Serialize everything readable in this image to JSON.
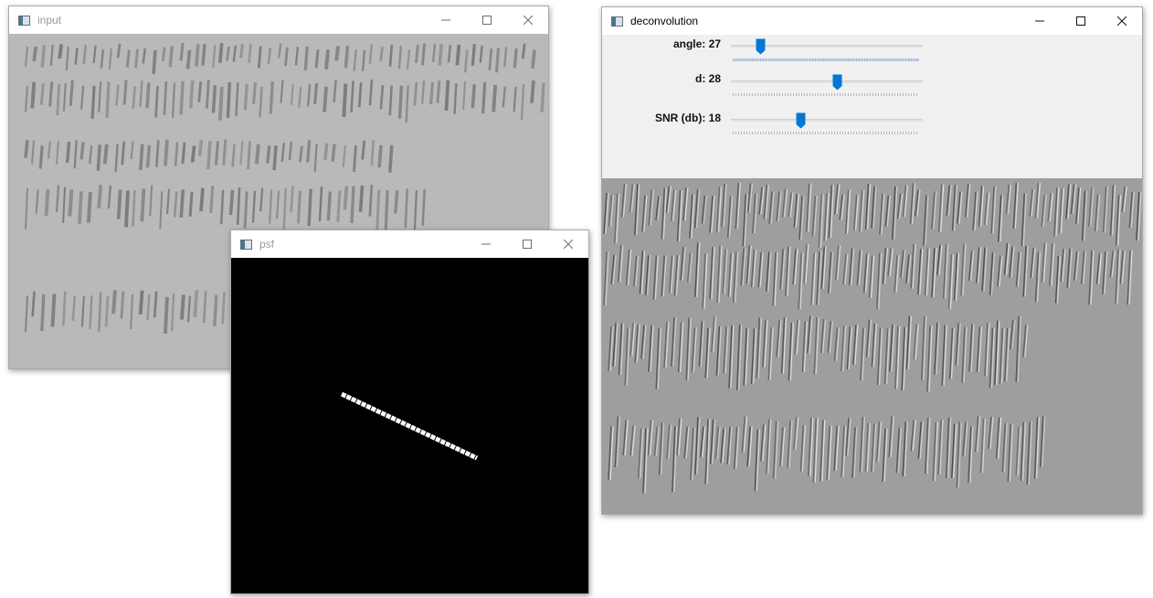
{
  "windows": {
    "input": {
      "title": "input"
    },
    "psf": {
      "title": "psf"
    },
    "deconvolution": {
      "title": "deconvolution",
      "trackbars": [
        {
          "label": "angle: 27",
          "value": 27,
          "fraction": 0.15
        },
        {
          "label": "d: 28",
          "value": 28,
          "fraction": 0.55
        },
        {
          "label": "SNR (db): 18",
          "value": 18,
          "fraction": 0.36
        }
      ]
    }
  },
  "colors": {
    "trackbar_thumb": "#0078d7",
    "psf_background": "#000000",
    "psf_line": "#ffffff"
  },
  "icons": [
    "app-icon",
    "minimize-icon",
    "maximize-icon",
    "close-icon"
  ]
}
